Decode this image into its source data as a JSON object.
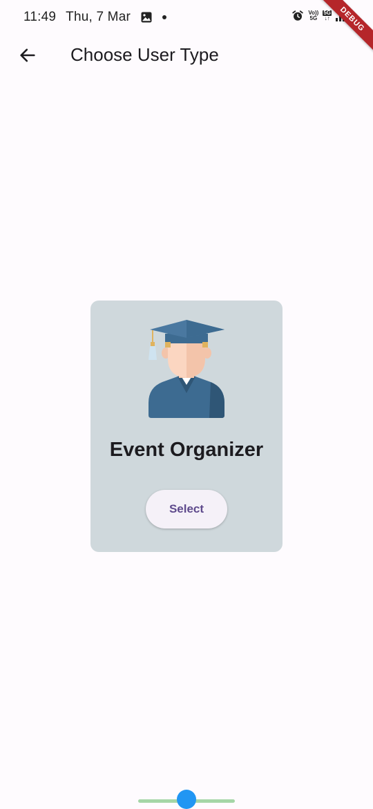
{
  "status_bar": {
    "time": "11:49",
    "date": "Thu, 7 Mar",
    "volte_top": "Vo))",
    "volte_bottom": "5G",
    "network_label": "5G"
  },
  "debug_banner": {
    "label": "DEBUG",
    "color": "#b5262a"
  },
  "app_bar": {
    "title": "Choose User Type",
    "back_icon": "arrow-back-icon"
  },
  "card": {
    "image_icon": "graduate-avatar-icon",
    "title": "Event Organizer",
    "button_label": "Select",
    "background_color": "#cfd8dc",
    "button_text_color": "#5e4a8c"
  },
  "colors": {
    "page_background": "#fefbfe",
    "nav_handle": "#a5d6a7",
    "nav_dot": "#2196f3"
  }
}
